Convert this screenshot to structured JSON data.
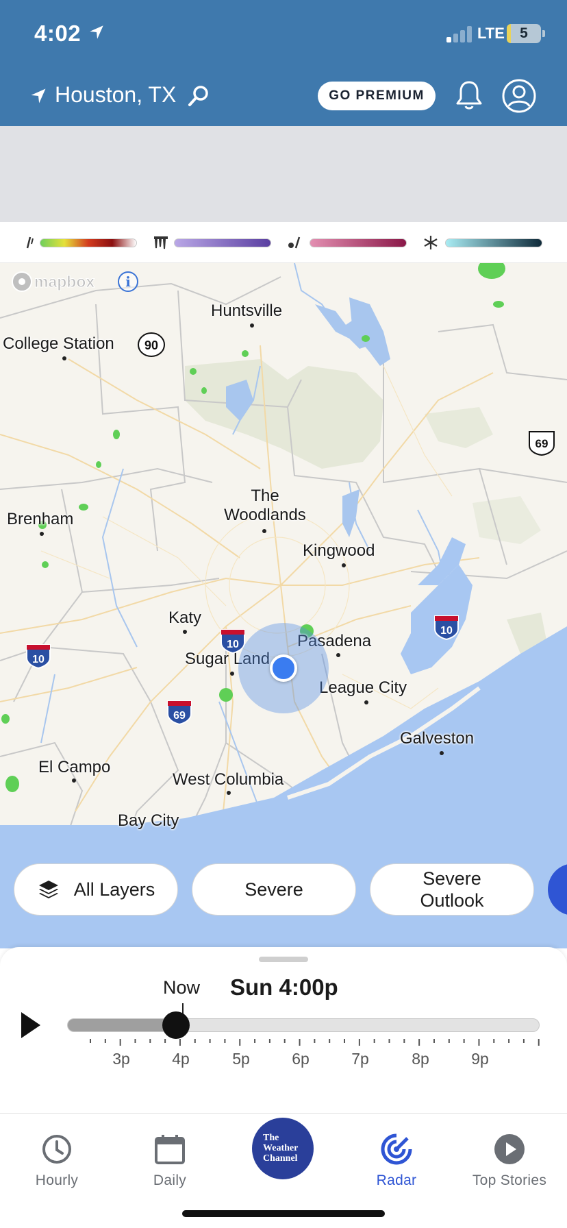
{
  "status_bar": {
    "time": "4:02",
    "network": "LTE",
    "battery": "5",
    "location_services_icon": "location-arrow-icon"
  },
  "header": {
    "location": "Houston, TX",
    "premium_label": "GO PREMIUM",
    "icons": [
      "location-arrow-icon",
      "search-icon",
      "bell-icon",
      "profile-icon"
    ]
  },
  "legend": {
    "items": [
      {
        "name": "rain",
        "icon": "rain-icon",
        "colors": [
          "#6fcf5c",
          "#e5e13a",
          "#d23b1e",
          "#8b1010",
          "#ffffff"
        ]
      },
      {
        "name": "ice",
        "icon": "ice-icon",
        "colors": [
          "#b9a7e6",
          "#5a3fa1"
        ]
      },
      {
        "name": "mix",
        "icon": "mix-icon",
        "colors": [
          "#e38fb1",
          "#8a1848"
        ]
      },
      {
        "name": "snow",
        "icon": "snowflake-icon",
        "colors": [
          "#a9ecf3",
          "#0f2a3a"
        ]
      }
    ]
  },
  "map": {
    "attribution": "mapbox",
    "info_label": "i",
    "cities": {
      "huntsville": "Huntsville",
      "college_station": "College Station",
      "the_woodlands": "The\nWoodlands",
      "brenham": "Brenham",
      "kingwood": "Kingwood",
      "katy": "Katy",
      "pasadena": "Pasadena",
      "sugar_land": "Sugar Land",
      "league_city": "League City",
      "galveston": "Galveston",
      "el_campo": "El Campo",
      "west_columbia": "West Columbia",
      "bay_city": "Bay City"
    },
    "shields": {
      "tx90": "90",
      "us69": "69",
      "i10_west": "10",
      "i10_center": "10",
      "i10_east": "10",
      "i69": "69"
    }
  },
  "layer_buttons": {
    "all_layers": "All Layers",
    "severe": "Severe",
    "severe_outlook": "Severe\nOutlook"
  },
  "timeline": {
    "now_label": "Now",
    "current_time": "Sun 4:00p",
    "progress_fraction": 0.23,
    "tick_labels": [
      "3p",
      "4p",
      "5p",
      "6p",
      "7p",
      "8p",
      "9p"
    ]
  },
  "bottom_nav": {
    "hourly": "Hourly",
    "daily": "Daily",
    "logo_lines": [
      "The",
      "Weather",
      "Channel"
    ],
    "radar": "Radar",
    "top_stories": "Top Stories",
    "active": "Radar"
  }
}
